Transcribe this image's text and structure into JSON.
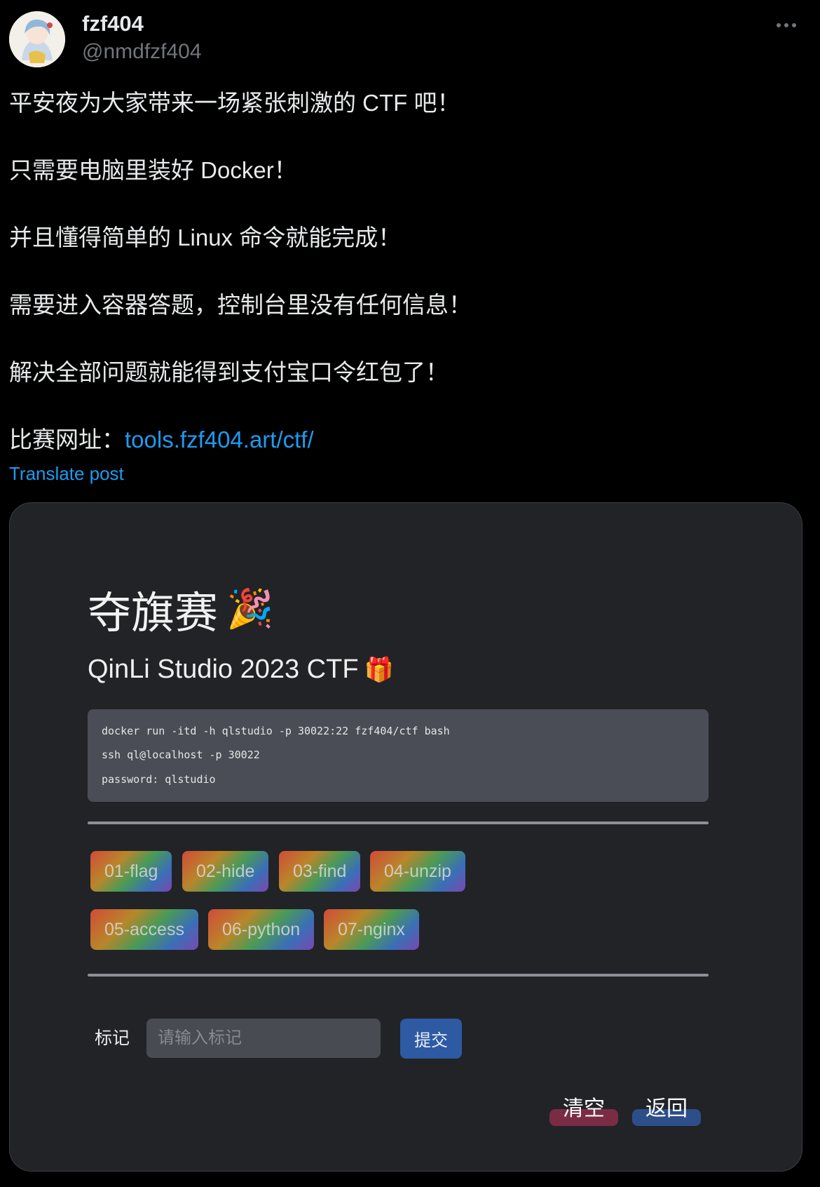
{
  "author": {
    "display_name": "fzf404",
    "handle": "@nmdfzf404"
  },
  "post": {
    "lines": [
      "平安夜为大家带来一场紧张刺激的 CTF 吧！",
      "只需要电脑里装好 Docker！",
      "并且懂得简单的 Linux 命令就能完成！",
      "需要进入容器答题，控制台里没有任何信息！",
      "解决全部问题就能得到支付宝口令红包了！"
    ],
    "url_prefix": "比赛网址：",
    "url_text": "tools.fzf404.art/ctf/",
    "translate_label": "Translate post"
  },
  "card": {
    "title": "夺旗赛",
    "title_emoji": "🎉",
    "subtitle": "QinLi Studio 2023 CTF",
    "subtitle_emoji": "🎁",
    "code_lines": [
      "docker run -itd -h qlstudio -p 30022:22 fzf404/ctf bash",
      "ssh ql@localhost -p 30022",
      "password: qlstudio"
    ],
    "challenges": [
      "01-flag",
      "02-hide",
      "03-find",
      "04-unzip",
      "05-access",
      "06-python",
      "07-nginx"
    ],
    "flag_label": "标记",
    "flag_placeholder": "请输入标记",
    "submit_label": "提交",
    "clear_label": "清空",
    "back_label": "返回"
  },
  "colors": {
    "background": "#000000",
    "link": "#1d9bf0",
    "card_bg": "#212327",
    "submit": "#2e5aa3",
    "clear": "#7a2c45",
    "back": "#2c4f8a"
  },
  "icons": [
    "more-icon",
    "party-popper-icon",
    "gift-icon"
  ]
}
